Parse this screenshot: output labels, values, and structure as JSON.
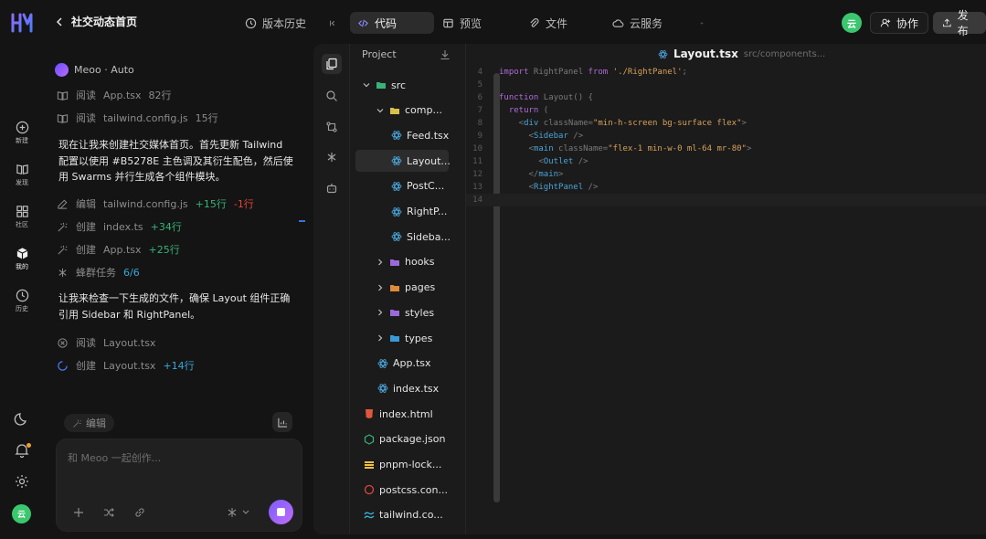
{
  "header": {
    "back_title": "社交动态首页",
    "tabs": [
      {
        "label": "版本历史",
        "icon": "history-icon"
      },
      {
        "label": "代码",
        "icon": "code-icon",
        "active": true
      },
      {
        "label": "预览",
        "icon": "preview-icon"
      },
      {
        "label": "文件",
        "icon": "attachment-icon"
      },
      {
        "label": "云服务",
        "icon": "cloud-icon"
      }
    ],
    "user_avatar": "云",
    "collab_label": "协作",
    "publish_label": "发布"
  },
  "rail": {
    "items": [
      {
        "label": "新建",
        "icon": "plus-circle-icon"
      },
      {
        "label": "发现",
        "icon": "book-icon"
      },
      {
        "label": "社区",
        "icon": "grid-icon"
      },
      {
        "label": "我的",
        "icon": "cube-icon",
        "active": true
      },
      {
        "label": "历史",
        "icon": "clock-icon"
      }
    ],
    "avatar": "云"
  },
  "chat": {
    "agent_name": "Meoo · Auto",
    "actions_top": [
      {
        "verb": "阅读",
        "file": "App.tsx",
        "count": "82行"
      },
      {
        "verb": "阅读",
        "file": "tailwind.config.js",
        "count": "15行"
      }
    ],
    "message1": "现在让我来创建社交媒体首页。首先更新 Tailwind 配置以使用 #B5278E 主色调及其衍生配色，然后使用 Swarms 并行生成各个组件模块。",
    "actions_mid": [
      {
        "verb": "编辑",
        "file": "tailwind.config.js",
        "add": "+15行",
        "del": "-1行"
      },
      {
        "verb": "创建",
        "file": "index.ts",
        "add": "+34行"
      },
      {
        "verb": "创建",
        "file": "App.tsx",
        "add": "+25行"
      },
      {
        "verb": "蜂群任务",
        "count": "6/6"
      }
    ],
    "message2": "让我来检查一下生成的文件，确保 Layout 组件正确引用 Sidebar 和 RightPanel。",
    "actions_bottom": [
      {
        "verb": "阅读",
        "file": "Layout.tsx"
      },
      {
        "verb": "创建",
        "file": "Layout.tsx",
        "add": "+14行"
      }
    ],
    "edit_chip": "编辑",
    "input_placeholder": "和 Meoo 一起创作..."
  },
  "explorer": {
    "title": "Project",
    "tree": [
      {
        "label": "src",
        "depth": 0,
        "kind": "folder-open",
        "color": "#37b27a"
      },
      {
        "label": "comp...",
        "depth": 1,
        "kind": "folder-open",
        "color": "#d8c04a"
      },
      {
        "label": "Feed.tsx",
        "depth": 2,
        "kind": "react"
      },
      {
        "label": "Layout...",
        "depth": 2,
        "kind": "react",
        "selected": true
      },
      {
        "label": "PostC...",
        "depth": 2,
        "kind": "react"
      },
      {
        "label": "RightP...",
        "depth": 2,
        "kind": "react"
      },
      {
        "label": "Sideba...",
        "depth": 2,
        "kind": "react"
      },
      {
        "label": "hooks",
        "depth": 1,
        "kind": "folder",
        "color": "#9a6ad8"
      },
      {
        "label": "pages",
        "depth": 1,
        "kind": "folder",
        "color": "#e08a3a"
      },
      {
        "label": "styles",
        "depth": 1,
        "kind": "folder",
        "color": "#9a6ad8"
      },
      {
        "label": "types",
        "depth": 1,
        "kind": "folder",
        "color": "#3a9ad8"
      },
      {
        "label": "App.tsx",
        "depth": 1,
        "kind": "react"
      },
      {
        "label": "index.tsx",
        "depth": 1,
        "kind": "react"
      },
      {
        "label": "index.html",
        "depth": 0,
        "kind": "html"
      },
      {
        "label": "package.json",
        "depth": 0,
        "kind": "node"
      },
      {
        "label": "pnpm-lock...",
        "depth": 0,
        "kind": "yaml"
      },
      {
        "label": "postcss.con...",
        "depth": 0,
        "kind": "postcss"
      },
      {
        "label": "tailwind.co...",
        "depth": 0,
        "kind": "tailwind"
      }
    ]
  },
  "editor": {
    "filename": "Layout.tsx",
    "path": "src/components...",
    "lines": [
      {
        "n": "4",
        "t": "import RightPanel from './RightPanel';"
      },
      {
        "n": "5",
        "t": ""
      },
      {
        "n": "6",
        "t": "function Layout() {"
      },
      {
        "n": "7",
        "t": "  return ("
      },
      {
        "n": "8",
        "t": "    <div className=\"min-h-screen bg-surface flex\">"
      },
      {
        "n": "9",
        "t": "      <Sidebar />"
      },
      {
        "n": "10",
        "t": "      <main className=\"flex-1 min-w-0 ml-64 mr-80\">"
      },
      {
        "n": "11",
        "t": "        <Outlet />"
      },
      {
        "n": "12",
        "t": "      </main>"
      },
      {
        "n": "13",
        "t": "      <RightPanel />"
      },
      {
        "n": "14",
        "t": ""
      }
    ]
  },
  "colors": {
    "accent": "#7b5cff",
    "add": "#37b27a",
    "del": "#e0463c",
    "avatar": "#3ac76e"
  }
}
